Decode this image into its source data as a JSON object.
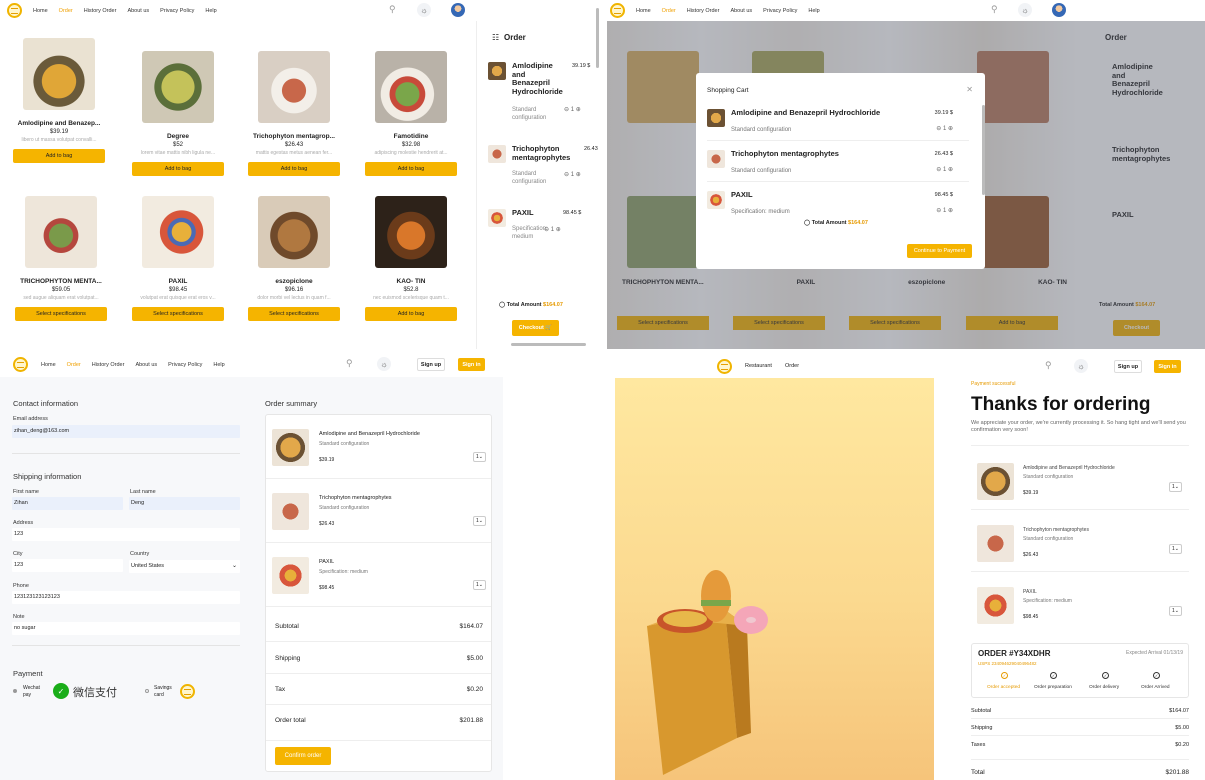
{
  "colors": {
    "accent": "#f5b400",
    "accent_text": "#e69a00"
  },
  "nav": {
    "home": "Home",
    "order": "Order",
    "history": "History Order",
    "about": "About us",
    "privacy": "Privacy Policy",
    "help": "Help",
    "signup": "Sign up",
    "signin": "Sign in",
    "restaurant": "Restaurant"
  },
  "products": [
    {
      "name": "Amlodipine and Benazep...",
      "price": "$39.19",
      "desc": "libero ut massa volutpat convalli...",
      "button": "Add to bag"
    },
    {
      "name": "Degree",
      "price": "$52",
      "desc": "lorem vitae mattis nibh ligula ne...",
      "button": "Add to bag"
    },
    {
      "name": "Trichophyton mentagrop...",
      "price": "$26.43",
      "desc": "mattis egestas metus aenean fer...",
      "button": "Add to bag"
    },
    {
      "name": "Famotidine",
      "price": "$32.98",
      "desc": "adipiscing molestie hendrerit at...",
      "button": "Add to bag"
    },
    {
      "name": "TRICHOPHYTON MENTA...",
      "price": "$59.05",
      "desc": "sed augue aliquam erat volutpat...",
      "button": "Select specifications"
    },
    {
      "name": "PAXIL",
      "price": "$98.45",
      "desc": "volutpat erat quisque erat eros v...",
      "button": "Select specifications"
    },
    {
      "name": "eszopiclone",
      "price": "$96.16",
      "desc": "dolor morbi vel lectus in quam f...",
      "button": "Select specifications"
    },
    {
      "name": "KAO- TIN",
      "price": "$52.8",
      "desc": "nec euismod scelerisque quam t...",
      "button": "Add to bag"
    }
  ],
  "order_panel": {
    "title": "Order",
    "items": [
      {
        "name": "Amlodipine and Benazepril Hydrochloride",
        "price": "39.19 $",
        "config": "Standard configuration",
        "qty": "1"
      },
      {
        "name": "Trichophyton mentagrophytes",
        "price": "26.43",
        "config": "Standard configuration",
        "qty": "1"
      },
      {
        "name": "PAXIL",
        "price": "98.45 $",
        "config": "Specification: medium",
        "qty": "1"
      }
    ],
    "total_label": "Total Amount",
    "total": "$164.07",
    "checkout": "Checkout"
  },
  "cart_modal": {
    "title": "Shopping Cart",
    "items": [
      {
        "name": "Amlodipine and Benazepril Hydrochloride",
        "price": "39.19 $",
        "config": "Standard configuration",
        "qty": "1"
      },
      {
        "name": "Trichophyton mentagrophytes",
        "price": "26.43 $",
        "config": "Standard configuration",
        "qty": "1"
      },
      {
        "name": "PAXIL",
        "price": "98.45 $",
        "config": "Specification: medium",
        "qty": "1"
      }
    ],
    "total_label": "Total Amount",
    "total": "$164.07",
    "continue": "Continue to Payment"
  },
  "checkout": {
    "contact_title": "Contact information",
    "email_label": "Email address",
    "email": "zihan_deng@163.com",
    "shipping_title": "Shipping information",
    "first_label": "First name",
    "first": "Zihan",
    "last_label": "Last name",
    "last": "Deng",
    "address_label": "Address",
    "address": "123",
    "city_label": "City",
    "city": "123",
    "country_label": "Country",
    "country": "United States",
    "phone_label": "Phone",
    "phone": "123123123123123",
    "note_label": "Note",
    "note": "no sugar",
    "payment_title": "Payment",
    "wechat": "Wechat pay",
    "wechat_brand": "微信支付",
    "savings": "Savings card"
  },
  "summary": {
    "title": "Order summary",
    "items": [
      {
        "name": "Amlodipine and Benazepril Hydrochloride",
        "config": "Standard configuration",
        "price": "$39.19",
        "qty": "1"
      },
      {
        "name": "Trichophyton mentagrophytes",
        "config": "Standard configuration",
        "price": "$26.43",
        "qty": "1"
      },
      {
        "name": "PAXIL",
        "config": "Specification: medium",
        "price": "$98.45",
        "qty": "1"
      }
    ],
    "subtotal_label": "Subtotal",
    "subtotal": "$164.07",
    "shipping_label": "Shipping",
    "shipping": "$5.00",
    "tax_label": "Tax",
    "tax": "$0.20",
    "total_label": "Order total",
    "total": "$201.88",
    "confirm": "Confirm order"
  },
  "thanks": {
    "status": "Payment successful",
    "title": "Thanks for ordering",
    "message": "We appreciate your order, we're currently processing it. So hang tight and we'll send you confirmation very soon!",
    "items": [
      {
        "name": "Amlodipine and Benazepril Hydrochloride",
        "config": "Standard configuration",
        "price": "$39.19",
        "qty": "1"
      },
      {
        "name": "Trichophyton mentagrophytes",
        "config": "Standard configuration",
        "price": "$26.43",
        "qty": "1"
      },
      {
        "name": "PAXIL",
        "config": "Specification: medium",
        "price": "$98.45",
        "qty": "1"
      }
    ],
    "order_no": "ORDER #Y34XDHR",
    "expected": "Expected Arrival 01/13/19",
    "tracking": "USPS 234094629040496482",
    "steps": [
      "Order accepted",
      "Order preparation",
      "Order delivery",
      "Order Arrived"
    ],
    "subtotal_label": "Subtotal",
    "subtotal": "$164.07",
    "shipping_label": "Shipping",
    "shipping": "$5.00",
    "taxes_label": "Taxes",
    "taxes": "$0.20",
    "total_label": "Total",
    "total": "$201.88"
  }
}
